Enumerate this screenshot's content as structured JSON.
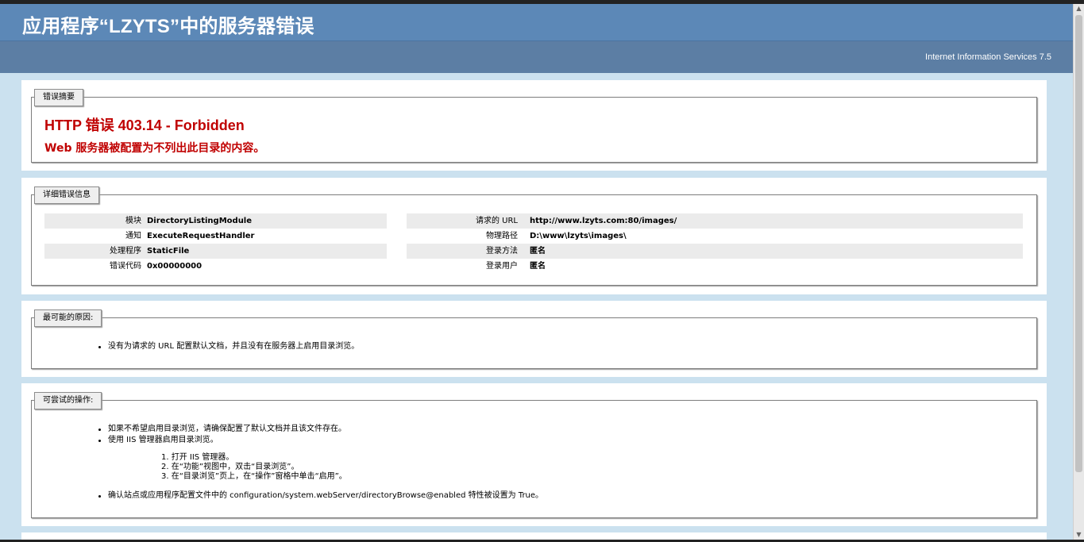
{
  "header": {
    "title": "应用程序“LZYTS”中的服务器错误",
    "server": "Internet Information Services 7.5"
  },
  "summary": {
    "legend": "错误摘要",
    "error_title": "HTTP 错误 403.14 - Forbidden",
    "error_message": "Web 服务器被配置为不列出此目录的内容。"
  },
  "details": {
    "legend": "详细错误信息",
    "left": [
      {
        "label": "模块",
        "value": "DirectoryListingModule"
      },
      {
        "label": "通知",
        "value": "ExecuteRequestHandler"
      },
      {
        "label": "处理程序",
        "value": "StaticFile"
      },
      {
        "label": "错误代码",
        "value": "0x00000000"
      }
    ],
    "right": [
      {
        "label": "请求的 URL",
        "value": "http://www.lzyts.com:80/images/"
      },
      {
        "label": "物理路径",
        "value": "D:\\www\\lzyts\\images\\"
      },
      {
        "label": "登录方法",
        "value": "匿名"
      },
      {
        "label": "登录用户",
        "value": "匿名"
      }
    ]
  },
  "causes": {
    "legend": "最可能的原因:",
    "items": [
      "没有为请求的 URL 配置默认文档，并且没有在服务器上启用目录浏览。"
    ]
  },
  "actions": {
    "legend": "可尝试的操作:",
    "items": [
      "如果不希望启用目录浏览，请确保配置了默认文档并且该文件存在。",
      "使用 IIS 管理器启用目录浏览。"
    ],
    "steps": [
      "1. 打开 IIS 管理器。",
      "2. 在“功能”视图中，双击“目录浏览”。",
      "3. 在“目录浏览”页上，在“操作”窗格中单击“启用”。"
    ],
    "last_item": "确认站点或应用程序配置文件中的 configuration/system.webServer/directoryBrowse@enabled 特性被设置为 True。"
  }
}
